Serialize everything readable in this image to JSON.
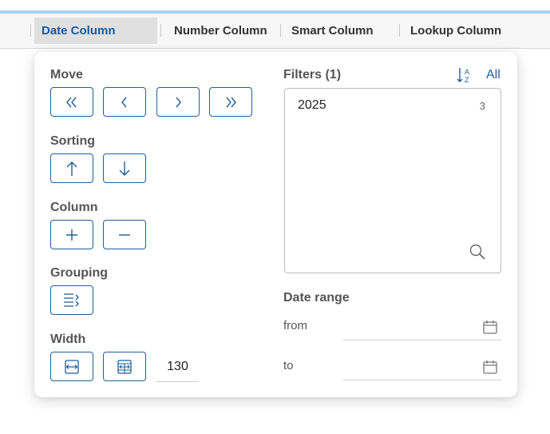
{
  "header": {
    "columns": [
      "Date Column",
      "Number Column",
      "Smart Column",
      "Lookup Column"
    ]
  },
  "menu": {
    "move_label": "Move",
    "sorting_label": "Sorting",
    "column_label": "Column",
    "grouping_label": "Grouping",
    "width_label": "Width",
    "width_value": "130"
  },
  "filters": {
    "title": "Filters (1)",
    "all_label": "All",
    "items": [
      {
        "label": "2025",
        "count": "3"
      }
    ]
  },
  "date_range": {
    "title": "Date range",
    "from_label": "from",
    "to_label": "to"
  },
  "icons": {
    "move_first": "double-chevron-left-icon",
    "move_prev": "chevron-left-icon",
    "move_next": "chevron-right-icon",
    "move_last": "double-chevron-right-icon",
    "sort_asc": "arrow-up-icon",
    "sort_desc": "arrow-down-icon",
    "add_column": "plus-icon",
    "remove_column": "minus-icon",
    "group": "group-rows-icon",
    "fit_width": "fit-width-icon",
    "fit_all": "fit-table-width-icon",
    "sort_az": "sort-az-icon",
    "search": "search-icon",
    "calendar": "calendar-icon"
  },
  "colors": {
    "accent": "#1f5e9a",
    "active_header_bg": "#e0e0e0",
    "top_bar": "#a9d1f5"
  }
}
